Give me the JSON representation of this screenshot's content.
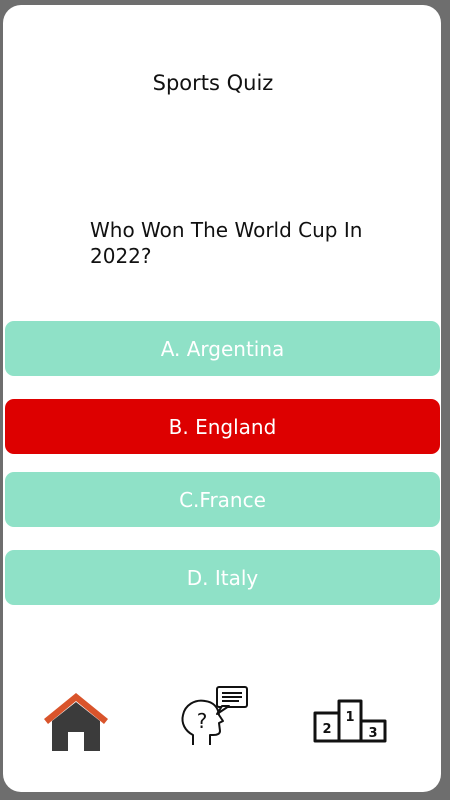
{
  "quiz": {
    "title": "Sports Quiz",
    "question": "Who Won The World Cup In 2022?"
  },
  "answers": [
    {
      "label": "A. Argentina",
      "state": "default"
    },
    {
      "label": "B. England",
      "state": "wrong"
    },
    {
      "label": "C.France",
      "state": "default"
    },
    {
      "label": "D. Italy",
      "state": "default"
    }
  ],
  "colors": {
    "answer_default": "#8fe1c7",
    "answer_wrong": "#dd0000",
    "home_roof": "#d9542b",
    "home_body": "#3b3b3b"
  },
  "nav": {
    "icons": [
      "home-icon",
      "quiz-thinking-head-icon",
      "leaderboard-podium-icon"
    ],
    "podium_places": [
      "2",
      "1",
      "3"
    ]
  }
}
